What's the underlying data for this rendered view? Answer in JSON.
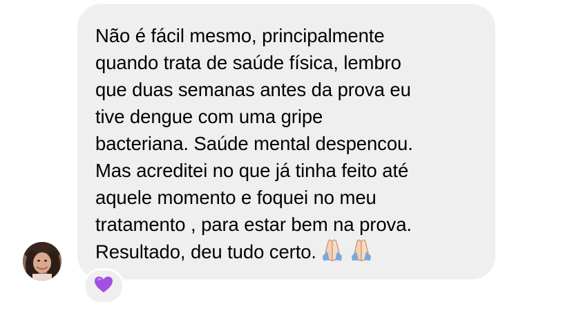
{
  "message": {
    "lines": [
      "Não é fácil mesmo, principalmente",
      "quando trata de saúde física, lembro",
      "que duas semanas antes da prova eu",
      "tive dengue com uma gripe",
      "bacteriana. Saúde mental despencou.",
      "Mas acreditei no que já tinha feito até",
      "aquele momento e foquei no meu",
      "tratamento , para estar bem na prova.",
      "Resultado, deu tudo certo."
    ],
    "trailing_emoji": [
      "praying-hands-icon",
      "praying-hands-icon"
    ],
    "bubble_color": "#efefef",
    "text_color": "#000000"
  },
  "sender": {
    "avatar_icon": "avatar-photo"
  },
  "reaction": {
    "icon": "purple-heart-icon",
    "color": "#a34fe5"
  }
}
